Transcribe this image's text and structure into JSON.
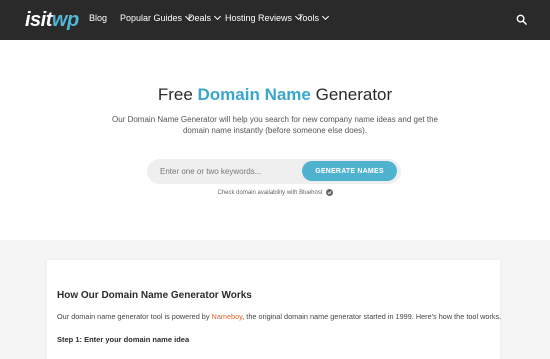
{
  "header": {
    "logo_part1": "isit",
    "logo_part2": "wp",
    "nav": [
      {
        "label": "Blog"
      },
      {
        "label": "Popular Guides"
      },
      {
        "label": "Deals"
      },
      {
        "label": "Hosting Reviews"
      },
      {
        "label": "Tools"
      }
    ]
  },
  "hero": {
    "title_prefix": "Free ",
    "title_highlight": "Domain Name",
    "title_suffix": " Generator",
    "description": "Our Domain Name Generator will help you search for new company name ideas and get the domain name instantly (before someone else does).",
    "search_placeholder": "Enter one or two keywords...",
    "button_label": "GENERATE NAMES",
    "check_note": "Check domain availability with Bluehost"
  },
  "section": {
    "title": "How Our Domain Name Generator Works",
    "text_before": "Our domain name generator tool is powered by ",
    "link_text": "Nameboy",
    "text_after": ", the original domain name generator started in 1999. Here's how the tool works.",
    "step1": "Step 1: Enter your domain name idea"
  },
  "colors": {
    "header_bg": "#2a2a2a",
    "accent": "#4fb3cf",
    "link": "#e0652b"
  }
}
